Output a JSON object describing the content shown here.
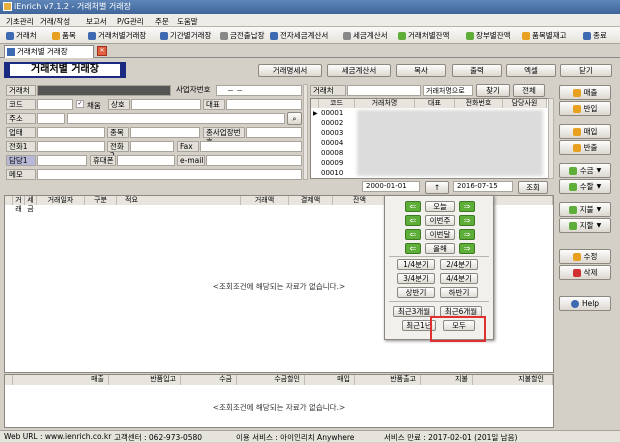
{
  "window": {
    "title": "iEnrich v7.1.2 - 거래처별 거래장"
  },
  "menu": [
    "기초관리",
    "거래/작성",
    "보고서",
    "P/G관리",
    "주문",
    "도움말"
  ],
  "toolbar": [
    "거래처",
    "품목",
    "거래처별거래장",
    "기간별거래장",
    "금전출납장",
    "전자세금계산서",
    "세금계산서",
    "거래처별잔액",
    "장부별잔액",
    "품목별재고",
    "종료"
  ],
  "tab": {
    "label": "거래처별 거래장",
    "close": "✕"
  },
  "page_title": "거래처별 거래장",
  "top_buttons": {
    "print_form": "거래명세서",
    "tax_invoice": "세금계산서",
    "copy": "복사",
    "output": "출력",
    "excel": "엑셀",
    "close": "닫기"
  },
  "form": {
    "customer": "거래처",
    "biz_no": "사업자번호",
    "biz_no_value": "－   －",
    "code": "코드",
    "checkbox_label": "채움",
    "company": "상호",
    "rep": "대표",
    "address": "주소",
    "business": "업태",
    "item": "종목",
    "workplace": "종사업장번호",
    "phone1": "전화1",
    "phone2": "전화2",
    "fax": "Fax",
    "manager": "담당1",
    "mobile": "휴대폰",
    "email": "e-mail",
    "memo": "메모"
  },
  "search": {
    "label": "거래처",
    "mode": "거래처명으로",
    "find": "찾기",
    "all": "전체"
  },
  "customer_grid": {
    "headers": [
      "코드",
      "거래처명",
      "대표",
      "전화번호",
      "담당사원"
    ],
    "codes": [
      "00001",
      "00002",
      "00003",
      "00004",
      "00008",
      "00009",
      "00010"
    ]
  },
  "date_range": {
    "from": "2000-01-01",
    "to": "2016-07-15",
    "toggle": "↑",
    "search": "조회"
  },
  "tx_grid": {
    "headers": [
      "거래",
      "세금",
      "거래일자",
      "구분",
      "적요",
      "거래액",
      "결제액",
      "잔액"
    ],
    "empty": "<조회조건에 해당되는 자료가 없습니다.>"
  },
  "popup": {
    "today": "오늘",
    "this_week": "이번주",
    "this_month": "이번달",
    "this_year": "올해",
    "q1": "1/4분기",
    "q2": "2/4분기",
    "q3": "3/4분기",
    "q4": "4/4분기",
    "h1": "상반기",
    "h2": "하반기",
    "m3": "최근3개월",
    "m6": "최근6개월",
    "y1": "최근1년",
    "all": "모두"
  },
  "summary_grid": {
    "headers": [
      "매출",
      "반품입고",
      "수금",
      "수금할인",
      "매입",
      "반품출고",
      "지불",
      "지불할인"
    ],
    "empty": "<조회조건에 해당되는 자료가 없습니다.>"
  },
  "side_buttons": [
    "매출",
    "반입",
    "매입",
    "반출",
    "수금",
    "수할",
    "지불",
    "지할",
    "수정",
    "삭제",
    "Help"
  ],
  "status": {
    "url": "Web URL : www.ienrich.co.kr",
    "center": "고객센터 : 062-973-0580",
    "service": "이용 서비스 : 아이인리치 Anywhere",
    "expiry": "서비스 만료 : 2017-02-01 (201일 남음)"
  },
  "colors": {
    "title_bar": "#4a72a8",
    "page_title_border": "#1a2a80",
    "highlight": "#e03030",
    "arrow_green": "#5fae3a"
  }
}
